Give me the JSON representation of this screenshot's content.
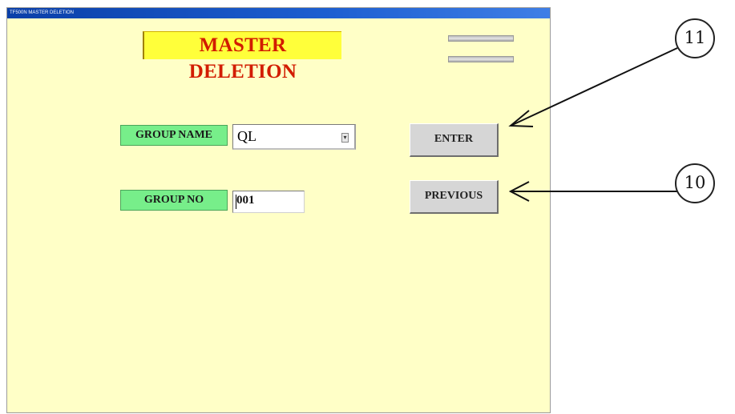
{
  "window": {
    "title": "TF500N MASTER DELETION"
  },
  "header": {
    "title": "MASTER DELETION"
  },
  "form": {
    "group_name": {
      "label": "GROUP NAME",
      "value": "QL"
    },
    "group_no": {
      "label": "GROUP NO",
      "value": "001"
    }
  },
  "buttons": {
    "enter": "ENTER",
    "previous": "PREVIOUS"
  },
  "annotations": {
    "enter_callout": "11",
    "previous_callout": "10"
  },
  "colors": {
    "background": "#ffffc7",
    "title_bg": "#ffff3a",
    "title_text": "#d21c00",
    "label_bg": "#77ee8a"
  },
  "icons": {
    "dropdown": "chevron-down-icon"
  }
}
